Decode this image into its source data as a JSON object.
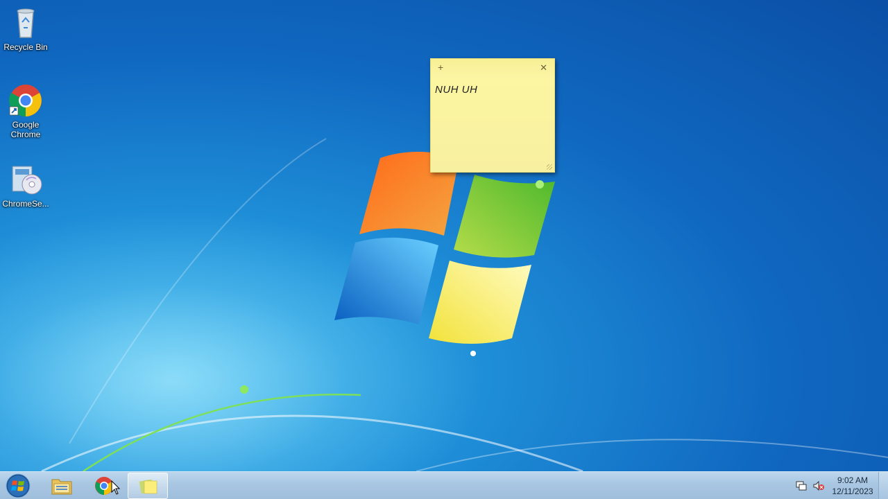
{
  "desktop": {
    "icons": [
      {
        "label": "Recycle Bin",
        "icon": "recycle-bin-icon"
      },
      {
        "label": "Google Chrome",
        "icon": "chrome-icon"
      },
      {
        "label": "ChromeSe...",
        "icon": "installer-icon"
      }
    ]
  },
  "sticky_note": {
    "text": "NUH UH",
    "new_note_symbol": "+",
    "close_symbol": "✕"
  },
  "taskbar": {
    "apps": [
      {
        "name": "windows-explorer",
        "icon": "folder-icon"
      },
      {
        "name": "google-chrome",
        "icon": "chrome-icon"
      },
      {
        "name": "sticky-notes",
        "icon": "sticky-notes-icon",
        "active": true
      }
    ],
    "tray": {
      "icons": [
        "network-icon",
        "volume-muted-icon"
      ],
      "time": "9:02 AM",
      "date": "12/11/2023"
    }
  },
  "colors": {
    "desktop_blue": "#1068c0",
    "sticky_yellow": "#fbf4a0",
    "taskbar": "#a9c6e2"
  }
}
